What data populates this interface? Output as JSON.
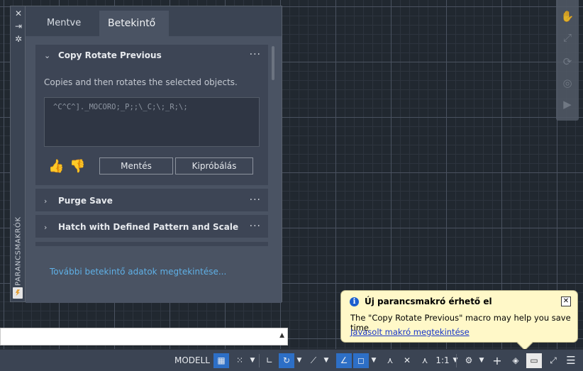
{
  "panel": {
    "vertical_title": "PARANCSMAKRÓK",
    "controls": [
      "close-icon",
      "pin-icon",
      "settings-icon"
    ],
    "tabs": [
      {
        "label": "Mentve",
        "active": false
      },
      {
        "label": "Betekintő …",
        "active": true
      }
    ],
    "macro_card": {
      "title": "Copy Rotate Previous",
      "description": "Copies and then rotates the selected objects.",
      "macro": "^C^C^]._MOCORO;_P;;\\_C;\\;_R;\\;",
      "save_label": "Mentés",
      "try_label": "Kipróbálás",
      "more_label": "···"
    },
    "rows": [
      {
        "title": "Purge Save",
        "more_label": "···"
      },
      {
        "title": "Hatch with Defined Pattern and Scale",
        "more_label": "···"
      }
    ],
    "more_link": "További betekintő adatok megtekintése..."
  },
  "notification": {
    "title": "Új parancsmakró érhető el",
    "message": "The \"Copy Rotate Previous\" macro may help you save time",
    "link": "Javasolt makró megtekintése",
    "close_label": "✕",
    "info_label": "i"
  },
  "statusbar": {
    "model_label": "MODELL",
    "scale_label": "1:1"
  },
  "colors": {
    "panel_bg": "#3b4453",
    "content_bg": "#4a5363",
    "accent": "#2d6fc6",
    "link": "#5fb0e6",
    "notification_bg": "#fff8c8"
  }
}
